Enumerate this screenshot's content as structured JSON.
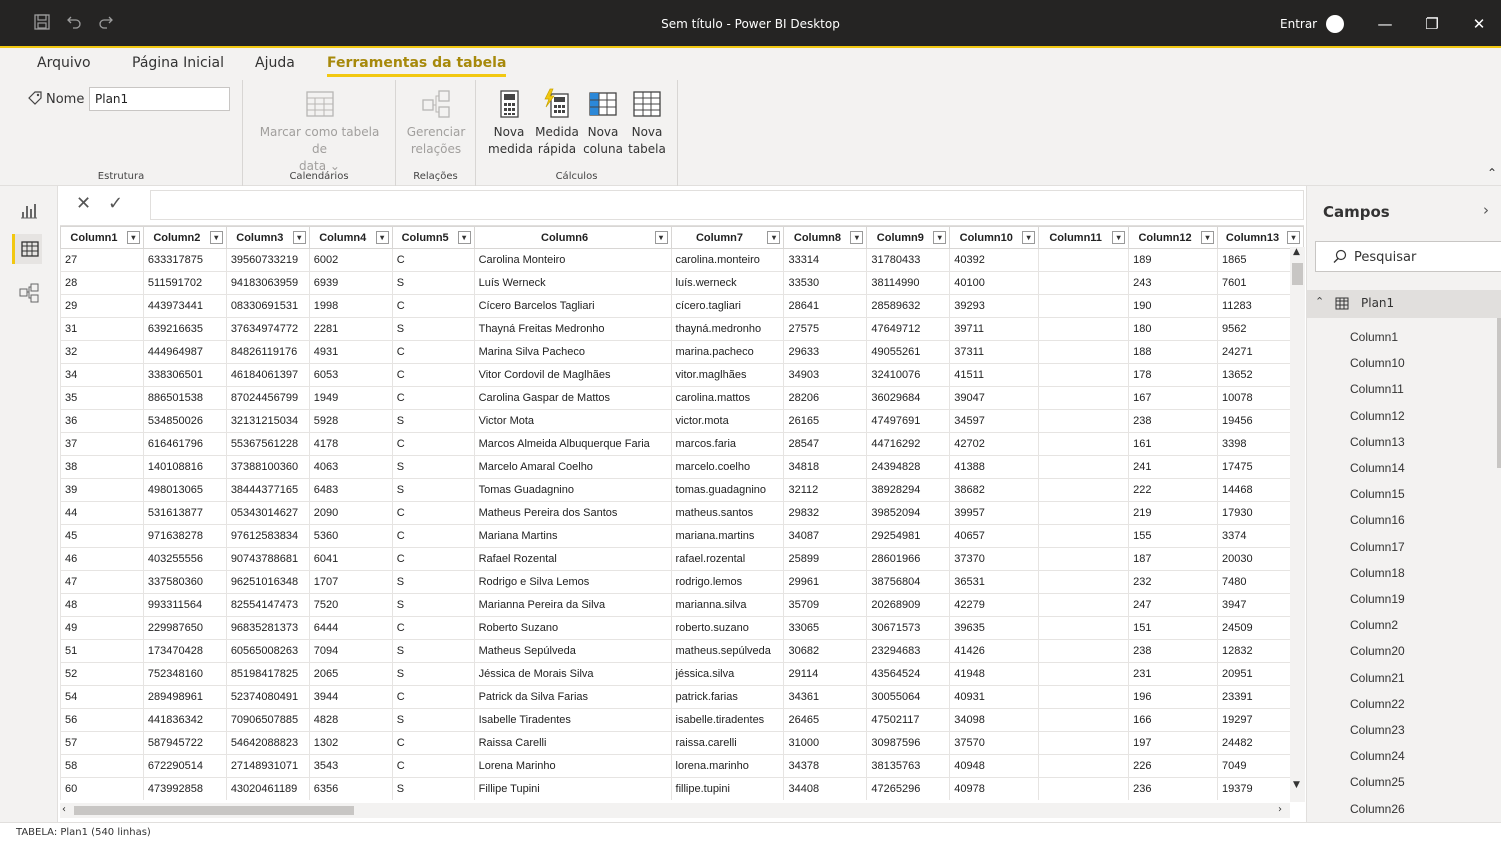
{
  "window": {
    "title": "Sem título - Power BI Desktop",
    "signin_label": "Entrar",
    "minimize_glyph": "—",
    "restore_glyph": "❐",
    "close_glyph": "✕"
  },
  "ribbon_tabs": [
    "Arquivo",
    "Página Inicial",
    "Ajuda",
    "Ferramentas da tabela"
  ],
  "ribbon": {
    "name_label": "Nome",
    "name_value": "Plan1",
    "groups": {
      "structure": "Estrutura",
      "calendars": "Calendários",
      "relations": "Relações",
      "calculations": "Cálculos"
    },
    "mark_date_table_line1": "Marcar como tabela de",
    "mark_date_table_line2": "data ⌄",
    "manage_relations_line1": "Gerenciar",
    "manage_relations_line2": "relações",
    "new_measure_line1": "Nova",
    "new_measure_line2": "medida",
    "quick_measure_line1": "Medida",
    "quick_measure_line2": "rápida",
    "new_column_line1": "Nova",
    "new_column_line2": "coluna",
    "new_table_line1": "Nova",
    "new_table_line2": "tabela",
    "accent_color": "#f2c811"
  },
  "formula_bar": {
    "cancel_glyph": "✕",
    "commit_glyph": "✓"
  },
  "columns": [
    "Column1",
    "Column2",
    "Column3",
    "Column4",
    "Column5",
    "Column6",
    "Column7",
    "Column8",
    "Column9",
    "Column10",
    "Column11",
    "Column12",
    "Column13"
  ],
  "rows": [
    [
      "27",
      "633317875",
      "39560733219",
      "6002",
      "C",
      "Carolina Monteiro",
      "carolina.monteiro",
      "33314",
      "31780433",
      "40392",
      "",
      "189",
      "1865"
    ],
    [
      "28",
      "511591702",
      "94183063959",
      "6939",
      "S",
      "Luís Werneck",
      "luís.werneck",
      "33530",
      "38114990",
      "40100",
      "",
      "243",
      "7601"
    ],
    [
      "29",
      "443973441",
      "08330691531",
      "1998",
      "C",
      "Cícero Barcelos Tagliari",
      "cícero.tagliari",
      "28641",
      "28589632",
      "39293",
      "",
      "190",
      "11283"
    ],
    [
      "31",
      "639216635",
      "37634974772",
      "2281",
      "S",
      "Thayná Freitas Medronho",
      "thayná.medronho",
      "27575",
      "47649712",
      "39711",
      "",
      "180",
      "9562"
    ],
    [
      "32",
      "444964987",
      "84826119176",
      "4931",
      "C",
      "Marina Silva Pacheco",
      "marina.pacheco",
      "29633",
      "49055261",
      "37311",
      "",
      "188",
      "24271"
    ],
    [
      "34",
      "338306501",
      "46184061397",
      "6053",
      "C",
      "Vitor Cordovil de Maglhães",
      "vitor.maglhães",
      "34903",
      "32410076",
      "41511",
      "",
      "178",
      "13652"
    ],
    [
      "35",
      "886501538",
      "87024456799",
      "1949",
      "C",
      "Carolina Gaspar de Mattos",
      "carolina.mattos",
      "28206",
      "36029684",
      "39047",
      "",
      "167",
      "10078"
    ],
    [
      "36",
      "534850026",
      "32131215034",
      "5928",
      "S",
      "Victor Mota",
      "victor.mota",
      "26165",
      "47497691",
      "34597",
      "",
      "238",
      "19456"
    ],
    [
      "37",
      "616461796",
      "55367561228",
      "4178",
      "C",
      "Marcos Almeida Albuquerque Faria",
      "marcos.faria",
      "28547",
      "44716292",
      "42702",
      "",
      "161",
      "3398"
    ],
    [
      "38",
      "140108816",
      "37388100360",
      "4063",
      "S",
      "Marcelo Amaral Coelho",
      "marcelo.coelho",
      "34818",
      "24394828",
      "41388",
      "",
      "241",
      "17475"
    ],
    [
      "39",
      "498013065",
      "38444377165",
      "6483",
      "S",
      "Tomas Guadagnino",
      "tomas.guadagnino",
      "32112",
      "38928294",
      "38682",
      "",
      "222",
      "14468"
    ],
    [
      "44",
      "531613877",
      "05343014627",
      "2090",
      "C",
      "Matheus Pereira dos Santos",
      "matheus.santos",
      "29832",
      "39852094",
      "39957",
      "",
      "219",
      "17930"
    ],
    [
      "45",
      "971638278",
      "97612583834",
      "5360",
      "C",
      "Mariana Martins",
      "mariana.martins",
      "34087",
      "29254981",
      "40657",
      "",
      "155",
      "3374"
    ],
    [
      "46",
      "403255556",
      "90743788681",
      "6041",
      "C",
      "Rafael Rozental",
      "rafael.rozental",
      "25899",
      "28601966",
      "37370",
      "",
      "187",
      "20030"
    ],
    [
      "47",
      "337580360",
      "96251016348",
      "1707",
      "S",
      "Rodrigo e Silva Lemos",
      "rodrigo.lemos",
      "29961",
      "38756804",
      "36531",
      "",
      "232",
      "7480"
    ],
    [
      "48",
      "993311564",
      "82554147473",
      "7520",
      "S",
      "Marianna Pereira da Silva",
      "marianna.silva",
      "35709",
      "20268909",
      "42279",
      "",
      "247",
      "3947"
    ],
    [
      "49",
      "229987650",
      "96835281373",
      "6444",
      "C",
      "Roberto Suzano",
      "roberto.suzano",
      "33065",
      "30671573",
      "39635",
      "",
      "151",
      "24509"
    ],
    [
      "51",
      "173470428",
      "60565008263",
      "7094",
      "S",
      "Matheus Sepúlveda",
      "matheus.sepúlveda",
      "30682",
      "23294683",
      "41426",
      "",
      "238",
      "12832"
    ],
    [
      "52",
      "752348160",
      "85198417825",
      "2065",
      "S",
      "Jéssica de Morais Silva",
      "jéssica.silva",
      "29114",
      "43564524",
      "41948",
      "",
      "231",
      "20951"
    ],
    [
      "54",
      "289498961",
      "52374080491",
      "3944",
      "C",
      "Patrick da Silva Farias",
      "patrick.farias",
      "34361",
      "30055064",
      "40931",
      "",
      "196",
      "23391"
    ],
    [
      "56",
      "441836342",
      "70906507885",
      "4828",
      "S",
      "Isabelle Tiradentes",
      "isabelle.tiradentes",
      "26465",
      "47502117",
      "34098",
      "",
      "166",
      "19297"
    ],
    [
      "57",
      "587945722",
      "54642088823",
      "1302",
      "C",
      "Raissa Carelli",
      "raissa.carelli",
      "31000",
      "30987596",
      "37570",
      "",
      "197",
      "24482"
    ],
    [
      "58",
      "672290514",
      "27148931071",
      "3543",
      "C",
      "Lorena Marinho",
      "lorena.marinho",
      "34378",
      "38135763",
      "40948",
      "",
      "226",
      "7049"
    ],
    [
      "60",
      "473992858",
      "43020461189",
      "6356",
      "S",
      "Fillipe Tupini",
      "fillipe.tupini",
      "34408",
      "47265296",
      "40978",
      "",
      "236",
      "19379"
    ]
  ],
  "fields_pane": {
    "title": "Campos",
    "search_placeholder": "Pesquisar",
    "table_name": "Plan1",
    "fields": [
      "Column1",
      "Column10",
      "Column11",
      "Column12",
      "Column13",
      "Column14",
      "Column15",
      "Column16",
      "Column17",
      "Column18",
      "Column19",
      "Column2",
      "Column20",
      "Column21",
      "Column22",
      "Column23",
      "Column24",
      "Column25",
      "Column26"
    ]
  },
  "status": {
    "text": "TABELA: Plan1 (540 linhas)"
  }
}
